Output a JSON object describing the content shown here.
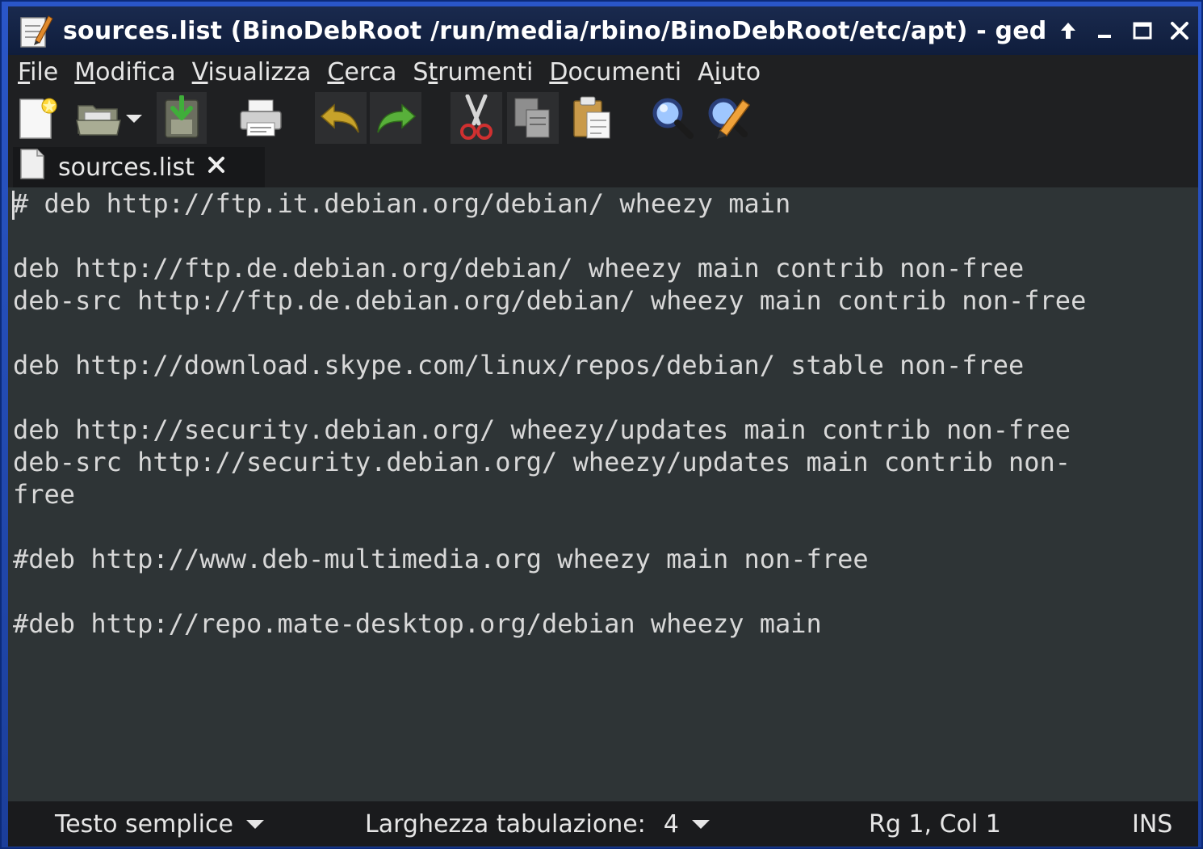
{
  "window": {
    "title": "sources.list (BinoDebRoot /run/media/rbino/BinoDebRoot/etc/apt) - ged",
    "controls": [
      "up-arrow-icon",
      "minimize-icon",
      "maximize-icon",
      "close-icon"
    ]
  },
  "menubar": {
    "items": [
      {
        "label": "File",
        "mnemonic_index": 0
      },
      {
        "label": "Modifica",
        "mnemonic_index": 0
      },
      {
        "label": "Visualizza",
        "mnemonic_index": 0
      },
      {
        "label": "Cerca",
        "mnemonic_index": 0
      },
      {
        "label": "Strumenti",
        "mnemonic_index": 1
      },
      {
        "label": "Documenti",
        "mnemonic_index": 0
      },
      {
        "label": "Aiuto",
        "mnemonic_index": 1
      }
    ]
  },
  "toolbar": {
    "buttons": [
      "new-document-icon",
      "open-icon",
      "open-dropdown-icon",
      "save-icon",
      "print-icon",
      "undo-icon",
      "redo-icon",
      "cut-icon",
      "copy-icon",
      "paste-icon",
      "find-icon",
      "find-replace-icon"
    ]
  },
  "tab": {
    "label": "sources.list"
  },
  "editor": {
    "lines": [
      "# deb http://ftp.it.debian.org/debian/ wheezy main",
      "",
      "deb http://ftp.de.debian.org/debian/ wheezy main contrib non-free",
      "deb-src http://ftp.de.debian.org/debian/ wheezy main contrib non-free",
      "",
      "deb http://download.skype.com/linux/repos/debian/ stable non-free",
      "",
      "deb http://security.debian.org/ wheezy/updates main contrib non-free",
      "deb-src http://security.debian.org/ wheezy/updates main contrib non-",
      "free",
      "",
      "#deb http://www.deb-multimedia.org wheezy main non-free",
      "",
      "#deb http://repo.mate-desktop.org/debian wheezy main"
    ]
  },
  "statusbar": {
    "language": "Testo semplice",
    "tab_width_label": "Larghezza tabulazione:",
    "tab_width_value": "4",
    "position": "Rg 1, Col 1",
    "mode": "INS"
  },
  "colors": {
    "editor_bg": "#2e3436",
    "editor_text": "#d8d8d8",
    "chrome_bg": "#1f2022",
    "frame": "#2a56c8"
  }
}
